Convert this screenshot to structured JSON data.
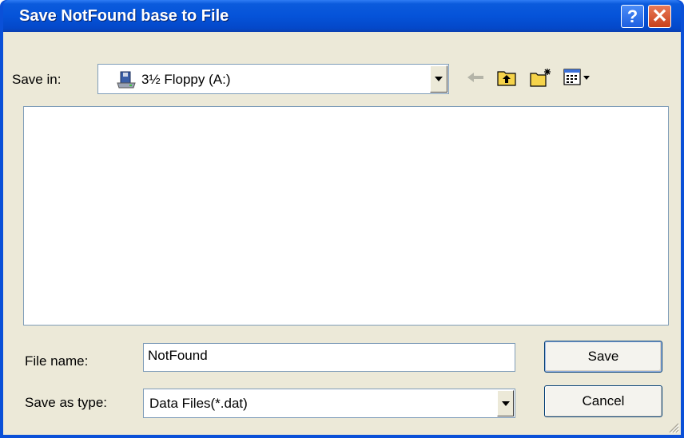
{
  "window": {
    "title": "Save NotFound base to File"
  },
  "titlebar": {
    "help_label": "?",
    "close_label": "✕"
  },
  "save_in": {
    "label": "Save in:",
    "value": "3½ Floppy (A:)",
    "icon": "floppy-drive-icon"
  },
  "toolbar": {
    "back_icon": "back-arrow-icon",
    "up_icon": "up-folder-icon",
    "new_folder_icon": "new-folder-icon",
    "views_icon": "views-menu-icon"
  },
  "file_list": {
    "items": []
  },
  "file_name": {
    "label": "File name:",
    "value": "NotFound"
  },
  "save_as_type": {
    "label": "Save as type:",
    "value": "Data Files(*.dat)"
  },
  "buttons": {
    "save": "Save",
    "cancel": "Cancel"
  },
  "colors": {
    "titlebar": "#0553d9",
    "dialog_bg": "#ece9d8",
    "close": "#c8401a"
  }
}
